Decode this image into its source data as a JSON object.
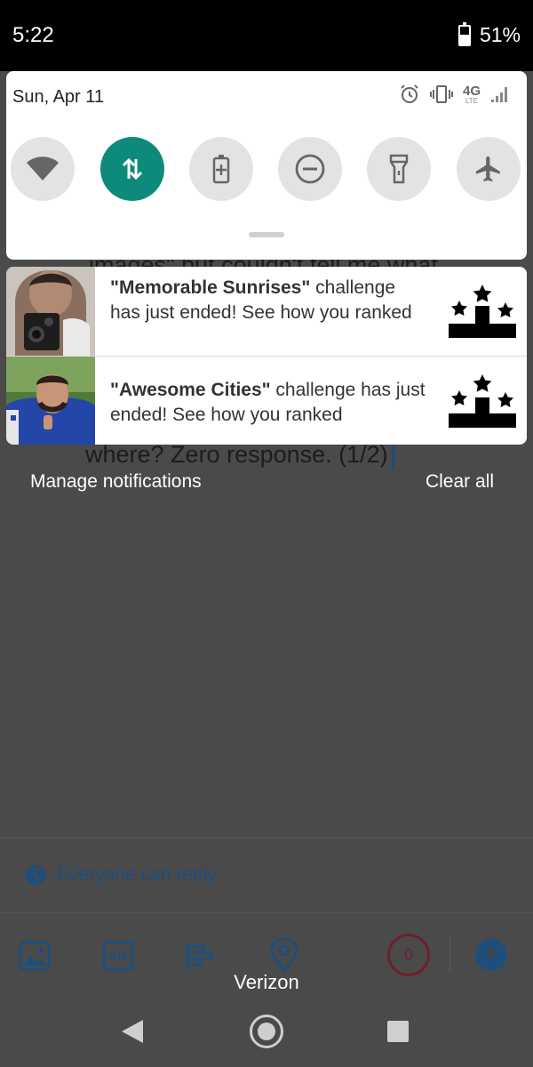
{
  "status_bar": {
    "time": "5:22",
    "battery": "51%"
  },
  "quick_settings": {
    "date": "Sun, Apr 11",
    "network_badge": "4G",
    "network_sub": "LTE",
    "tiles": [
      {
        "name": "wifi",
        "icon": "wifi-icon",
        "active": false
      },
      {
        "name": "mobile-data",
        "icon": "data-arrows-icon",
        "active": true
      },
      {
        "name": "battery-saver",
        "icon": "battery-saver-icon",
        "active": false
      },
      {
        "name": "do-not-disturb",
        "icon": "dnd-icon",
        "active": false
      },
      {
        "name": "flashlight",
        "icon": "flashlight-icon",
        "active": false
      },
      {
        "name": "airplane-mode",
        "icon": "airplane-icon",
        "active": false
      }
    ],
    "accent": "#0e8a7a"
  },
  "notifications": [
    {
      "title": "\"Memorable Sunrises\"",
      "rest": " challenge has just ended! See how you ranked"
    },
    {
      "title": "\"Awesome Cities\"",
      "rest": " challenge has just ended! See how you ranked"
    }
  ],
  "notification_actions": {
    "manage": "Manage notifications",
    "clear": "Clear all"
  },
  "background_app": {
    "tweet_text_top": "images\" but couldn't tell me what",
    "tweet_text": "where? Zero response. (1/2)",
    "reply_setting": "Everyone can reply",
    "char_counter": "0",
    "carrier": "Verizon"
  }
}
